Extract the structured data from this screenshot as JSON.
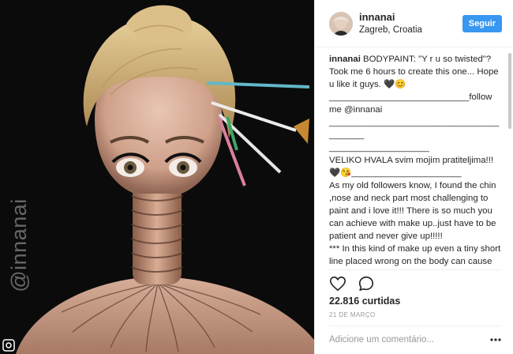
{
  "post": {
    "watermark": "@innanai",
    "photo_label": "bodypaint-photo"
  },
  "header": {
    "username": "innanai",
    "location": "Zagreb, Croatia",
    "follow_label": "Seguir"
  },
  "caption": {
    "username": "innanai",
    "text": " BODYPAINT: \"Y r u so twisted\"? Took me 6 hours to create this one... Hope u like it guys. 🖤😊\n____________________________follow me @innanai\n_________________________________________\n____________________\nVELIKO HVALA svim mojim pratiteljima!!! 🖤😘______________________\nAs my old followers know, I found the chin ,nose and neck part most challenging to paint and i love it!!! There is so much you can achieve with make up..just have to be patient and never give up!!!!!\n*** In this kind of make up even a tiny short line placed wrong on the body can cause much damage to the final look so I have to be very careful and also do lot's of preparations in my head . ***\nP.s. my chin is in the tirdth and fourth row from top and I painted my fingers to"
  },
  "stats": {
    "likes": "22.816 curtidas",
    "date": "21 DE MARÇO"
  },
  "comment_box": {
    "placeholder": "Adicione um comentário..."
  },
  "icons": {
    "like": "heart-icon",
    "comment": "comment-icon",
    "more": "more-options-icon",
    "corner": "instagram-logo-icon"
  },
  "colors": {
    "follow_button": "#3897f0",
    "photo_background": "#0b0b0b",
    "muted_text": "#999999"
  }
}
